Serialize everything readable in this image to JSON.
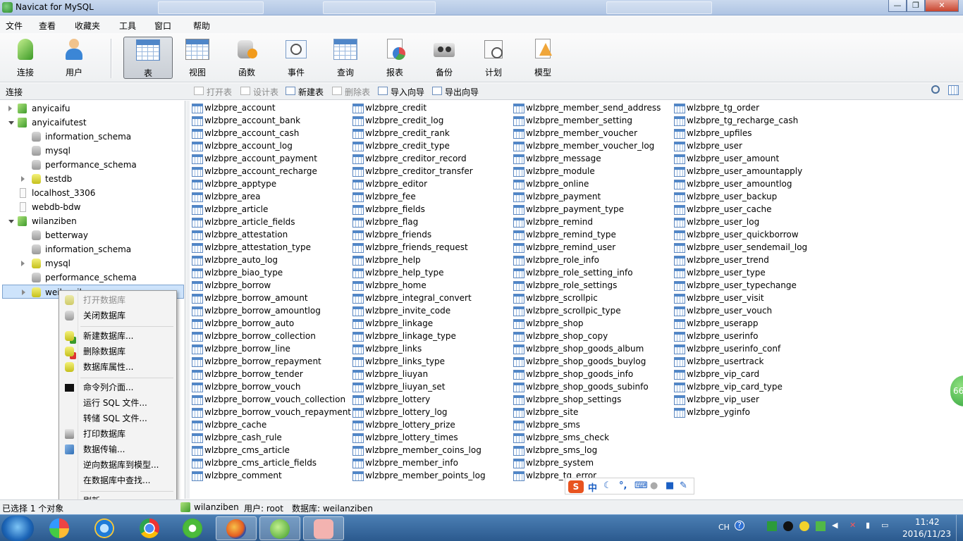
{
  "window": {
    "title": "Navicat for MySQL"
  },
  "menu": [
    "文件",
    "查看",
    "收藏夹",
    "工具",
    "窗口",
    "帮助"
  ],
  "toolbar": [
    "连接",
    "用户",
    "表",
    "视图",
    "函数",
    "事件",
    "查询",
    "报表",
    "备份",
    "计划",
    "模型"
  ],
  "toolbar_active": "表",
  "subbar": {
    "connection_label": "连接",
    "buttons": [
      "打开表",
      "设计表",
      "新建表",
      "删除表",
      "导入向导",
      "导出向导"
    ]
  },
  "tree": [
    {
      "label": "anyicaifu"
    },
    {
      "label": "anyicaifutest"
    },
    {
      "label": "information_schema"
    },
    {
      "label": "mysql"
    },
    {
      "label": "performance_schema"
    },
    {
      "label": "testdb"
    },
    {
      "label": "localhost_3306"
    },
    {
      "label": "webdb-bdw"
    },
    {
      "label": "wilanziben"
    },
    {
      "label": "betterway"
    },
    {
      "label": "information_schema"
    },
    {
      "label": "mysql"
    },
    {
      "label": "performance_schema"
    },
    {
      "label": "weilanziben"
    }
  ],
  "tables": {
    "col1": [
      "wlzbpre_account",
      "wlzbpre_account_bank",
      "wlzbpre_account_cash",
      "wlzbpre_account_log",
      "wlzbpre_account_payment",
      "wlzbpre_account_recharge",
      "wlzbpre_apptype",
      "wlzbpre_area",
      "wlzbpre_article",
      "wlzbpre_article_fields",
      "wlzbpre_attestation",
      "wlzbpre_attestation_type",
      "wlzbpre_auto_log",
      "wlzbpre_biao_type",
      "wlzbpre_borrow",
      "wlzbpre_borrow_amount",
      "wlzbpre_borrow_amountlog",
      "wlzbpre_borrow_auto",
      "wlzbpre_borrow_collection",
      "wlzbpre_borrow_line",
      "wlzbpre_borrow_repayment",
      "wlzbpre_borrow_tender",
      "wlzbpre_borrow_vouch",
      "wlzbpre_borrow_vouch_collection",
      "wlzbpre_borrow_vouch_repayment",
      "wlzbpre_cache",
      "wlzbpre_cash_rule",
      "wlzbpre_cms_article",
      "wlzbpre_cms_article_fields",
      "wlzbpre_comment"
    ],
    "col2": [
      "wlzbpre_credit",
      "wlzbpre_credit_log",
      "wlzbpre_credit_rank",
      "wlzbpre_credit_type",
      "wlzbpre_creditor_record",
      "wlzbpre_creditor_transfer",
      "wlzbpre_editor",
      "wlzbpre_fee",
      "wlzbpre_fields",
      "wlzbpre_flag",
      "wlzbpre_friends",
      "wlzbpre_friends_request",
      "wlzbpre_help",
      "wlzbpre_help_type",
      "wlzbpre_home",
      "wlzbpre_integral_convert",
      "wlzbpre_invite_code",
      "wlzbpre_linkage",
      "wlzbpre_linkage_type",
      "wlzbpre_links",
      "wlzbpre_links_type",
      "wlzbpre_liuyan",
      "wlzbpre_liuyan_set",
      "wlzbpre_lottery",
      "wlzbpre_lottery_log",
      "wlzbpre_lottery_prize",
      "wlzbpre_lottery_times",
      "wlzbpre_member_coins_log",
      "wlzbpre_member_info",
      "wlzbpre_member_points_log"
    ],
    "col3": [
      "wlzbpre_member_send_address",
      "wlzbpre_member_setting",
      "wlzbpre_member_voucher",
      "wlzbpre_member_voucher_log",
      "wlzbpre_message",
      "wlzbpre_module",
      "wlzbpre_online",
      "wlzbpre_payment",
      "wlzbpre_payment_type",
      "wlzbpre_remind",
      "wlzbpre_remind_type",
      "wlzbpre_remind_user",
      "wlzbpre_role_info",
      "wlzbpre_role_setting_info",
      "wlzbpre_role_settings",
      "wlzbpre_scrollpic",
      "wlzbpre_scrollpic_type",
      "wlzbpre_shop",
      "wlzbpre_shop_copy",
      "wlzbpre_shop_goods_album",
      "wlzbpre_shop_goods_buylog",
      "wlzbpre_shop_goods_info",
      "wlzbpre_shop_goods_subinfo",
      "wlzbpre_shop_settings",
      "wlzbpre_site",
      "wlzbpre_sms",
      "wlzbpre_sms_check",
      "wlzbpre_sms_log",
      "wlzbpre_system",
      "wlzbpre_tg_error"
    ],
    "col4": [
      "wlzbpre_tg_order",
      "wlzbpre_tg_recharge_cash",
      "wlzbpre_upfiles",
      "wlzbpre_user",
      "wlzbpre_user_amount",
      "wlzbpre_user_amountapply",
      "wlzbpre_user_amountlog",
      "wlzbpre_user_backup",
      "wlzbpre_user_cache",
      "wlzbpre_user_log",
      "wlzbpre_user_quickborrow",
      "wlzbpre_user_sendemail_log",
      "wlzbpre_user_trend",
      "wlzbpre_user_type",
      "wlzbpre_user_typechange",
      "wlzbpre_user_visit",
      "wlzbpre_user_vouch",
      "wlzbpre_userapp",
      "wlzbpre_userinfo",
      "wlzbpre_userinfo_conf",
      "wlzbpre_usertrack",
      "wlzbpre_vip_card",
      "wlzbpre_vip_card_type",
      "wlzbpre_vip_user",
      "wlzbpre_yginfo"
    ]
  },
  "context_menu": [
    {
      "label": "打开数据库",
      "disabled": true
    },
    {
      "label": "关闭数据库",
      "disabled": false
    },
    {
      "label": "新建数据库...",
      "disabled": false
    },
    {
      "label": "删除数据库",
      "disabled": false
    },
    {
      "label": "数据库属性...",
      "disabled": false
    },
    {
      "label": "命令列介面...",
      "disabled": false
    },
    {
      "label": "运行 SQL 文件...",
      "disabled": false
    },
    {
      "label": "转储 SQL 文件...",
      "disabled": false
    },
    {
      "label": "打印数据库",
      "disabled": false
    },
    {
      "label": "数据传输...",
      "disabled": false
    },
    {
      "label": "逆向数据库到模型...",
      "disabled": false
    },
    {
      "label": "在数据库中查找...",
      "disabled": false
    },
    {
      "label": "刷新",
      "disabled": false
    }
  ],
  "status": {
    "selection": "已选择 1 个对象",
    "connection": "wilanziben",
    "user": "用户: root",
    "database": "数据库: weilanziben"
  },
  "float_badge": "66",
  "ime": {
    "lang": "中"
  },
  "taskbar": {
    "tray_lang": "CH",
    "time": "11:42",
    "date": "2016/11/23"
  },
  "colors": {
    "selection": "#cde3fb",
    "taskbar": "#2b5a8e",
    "table_icon": "#4f86c8"
  }
}
